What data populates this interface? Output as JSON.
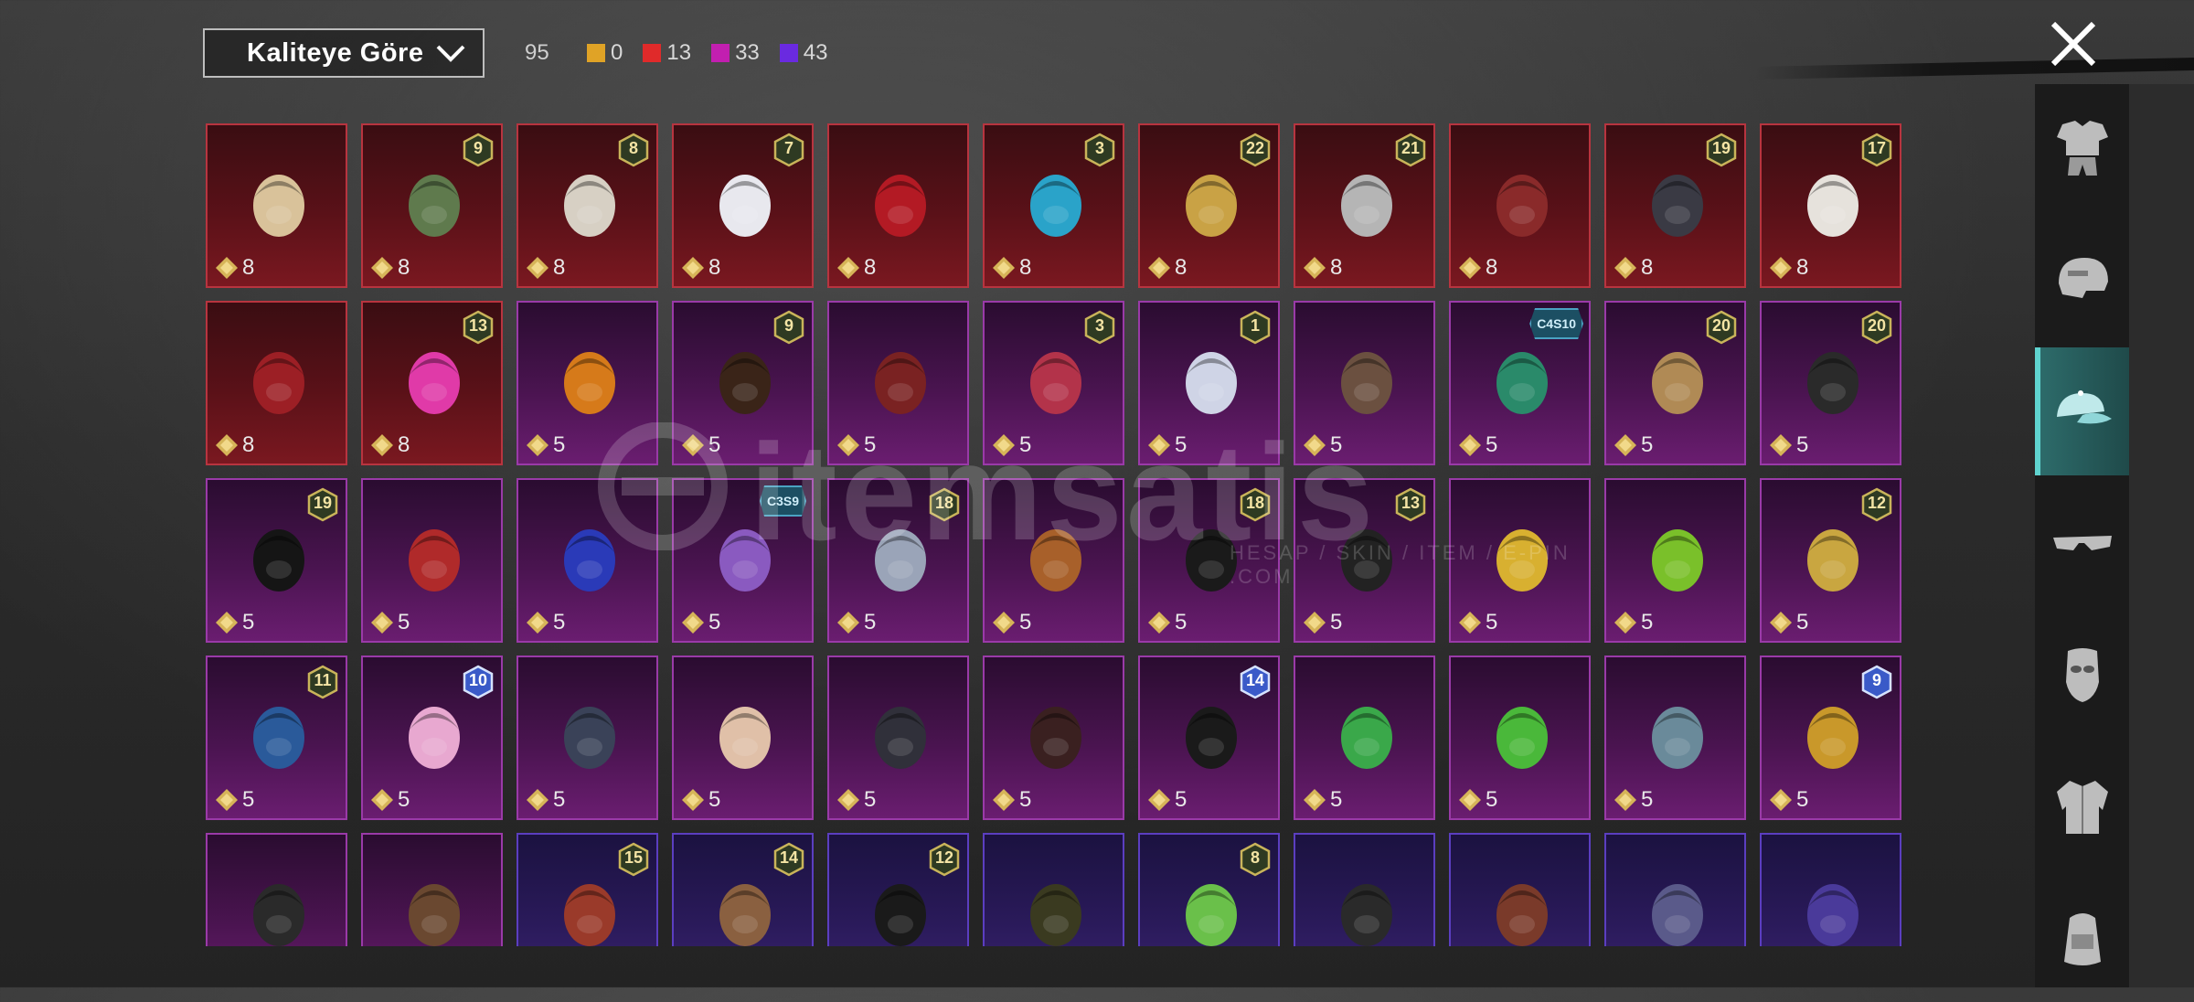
{
  "topbar": {
    "sort_label": "Kaliteye Göre",
    "total": "95",
    "rarity_counts": [
      {
        "color": "#e0a326",
        "count": "0"
      },
      {
        "color": "#e02a2a",
        "count": "13"
      },
      {
        "color": "#c21fb0",
        "count": "33"
      },
      {
        "color": "#6a2ae0",
        "count": "43"
      }
    ]
  },
  "watermark": {
    "text": "itemsatis",
    "sub": "HESAP / SKIN / ITEM / E-PIN .COM"
  },
  "categories": [
    {
      "name": "outfit-icon",
      "active": false
    },
    {
      "name": "helmet-icon",
      "active": false
    },
    {
      "name": "cap-icon",
      "active": true
    },
    {
      "name": "glasses-icon",
      "active": false
    },
    {
      "name": "mask-icon",
      "active": false
    },
    {
      "name": "jacket-icon",
      "active": false
    },
    {
      "name": "backpack-icon",
      "active": false
    }
  ],
  "items": [
    {
      "rarity": "red",
      "level": "",
      "price": "8",
      "art": "#d9c29a"
    },
    {
      "rarity": "red",
      "level": "9",
      "price": "8",
      "art": "#5f7a4d"
    },
    {
      "rarity": "red",
      "level": "8",
      "price": "8",
      "art": "#d7d0c4"
    },
    {
      "rarity": "red",
      "level": "7",
      "price": "8",
      "art": "#e8e8ee"
    },
    {
      "rarity": "red",
      "level": "",
      "price": "8",
      "art": "#b31a24"
    },
    {
      "rarity": "red",
      "level": "3",
      "price": "8",
      "art": "#2aa3c9"
    },
    {
      "rarity": "red",
      "level": "22",
      "price": "8",
      "art": "#c9a245"
    },
    {
      "rarity": "red",
      "level": "21",
      "price": "8",
      "art": "#b5b5b5"
    },
    {
      "rarity": "red",
      "level": "",
      "price": "8",
      "art": "#8a2a2a"
    },
    {
      "rarity": "red",
      "level": "19",
      "price": "8",
      "art": "#3a3a44"
    },
    {
      "rarity": "red",
      "level": "17",
      "price": "8",
      "art": "#e6e2dc"
    },
    {
      "rarity": "red",
      "level": "",
      "price": "8",
      "art": "#9c1f25"
    },
    {
      "rarity": "red",
      "level": "13",
      "price": "8",
      "art": "#e03aa8"
    },
    {
      "rarity": "purple",
      "level": "",
      "price": "5",
      "art": "#d67a1a"
    },
    {
      "rarity": "purple",
      "level": "9",
      "price": "5",
      "art": "#3a2418"
    },
    {
      "rarity": "purple",
      "level": "",
      "price": "5",
      "art": "#7a2222"
    },
    {
      "rarity": "purple",
      "level": "3",
      "price": "5",
      "art": "#b3334a"
    },
    {
      "rarity": "purple",
      "level": "1",
      "price": "5",
      "art": "#cfd4e6"
    },
    {
      "rarity": "purple",
      "level": "",
      "price": "5",
      "art": "#6b5040"
    },
    {
      "rarity": "purple",
      "level": "",
      "tag": "C4S10",
      "price": "5",
      "art": "#2a8a6a"
    },
    {
      "rarity": "purple",
      "level": "20",
      "price": "5",
      "art": "#b08a55"
    },
    {
      "rarity": "purple",
      "level": "20",
      "price": "5",
      "art": "#2a2a2a"
    },
    {
      "rarity": "purple",
      "level": "19",
      "price": "5",
      "art": "#151515"
    },
    {
      "rarity": "purple",
      "level": "",
      "price": "5",
      "art": "#b02a2a"
    },
    {
      "rarity": "purple",
      "level": "",
      "price": "5",
      "art": "#2a3ab8"
    },
    {
      "rarity": "purple",
      "level": "",
      "tag": "C3S9",
      "price": "5",
      "art": "#8a5ac0"
    },
    {
      "rarity": "purple",
      "level": "18",
      "price": "5",
      "art": "#9aa4b8"
    },
    {
      "rarity": "purple",
      "level": "",
      "price": "5",
      "art": "#a8602a"
    },
    {
      "rarity": "purple",
      "level": "18",
      "price": "5",
      "art": "#1a1a1a"
    },
    {
      "rarity": "purple",
      "level": "13",
      "price": "5",
      "art": "#222222"
    },
    {
      "rarity": "purple",
      "level": "",
      "price": "5",
      "art": "#d8b030"
    },
    {
      "rarity": "purple",
      "level": "",
      "price": "5",
      "art": "#7ac02a"
    },
    {
      "rarity": "purple",
      "level": "12",
      "price": "5",
      "art": "#c9a640"
    },
    {
      "rarity": "purple",
      "level": "11",
      "price": "5",
      "art": "#2a5a9a"
    },
    {
      "rarity": "purple",
      "level": "10",
      "blue": true,
      "price": "5",
      "art": "#e8a8d0"
    },
    {
      "rarity": "purple",
      "level": "",
      "price": "5",
      "art": "#3a4258"
    },
    {
      "rarity": "purple",
      "level": "",
      "price": "5",
      "art": "#e0c0a8"
    },
    {
      "rarity": "purple",
      "level": "",
      "price": "5",
      "art": "#30303a"
    },
    {
      "rarity": "purple",
      "level": "",
      "price": "5",
      "art": "#3a2020"
    },
    {
      "rarity": "purple",
      "level": "14",
      "blue": true,
      "price": "5",
      "art": "#1a1a1a"
    },
    {
      "rarity": "purple",
      "level": "",
      "price": "5",
      "art": "#3aa84a"
    },
    {
      "rarity": "purple",
      "level": "",
      "price": "5",
      "art": "#4ab83a"
    },
    {
      "rarity": "purple",
      "level": "",
      "price": "5",
      "art": "#6a8a9a"
    },
    {
      "rarity": "purple",
      "level": "9",
      "blue": true,
      "price": "5",
      "art": "#c9982a"
    },
    {
      "rarity": "purple",
      "level": "",
      "price": "",
      "art": "#2a2a2a"
    },
    {
      "rarity": "purple",
      "level": "",
      "price": "",
      "art": "#6a4830"
    },
    {
      "rarity": "violet",
      "level": "15",
      "price": "",
      "art": "#9a3a2a"
    },
    {
      "rarity": "violet",
      "level": "14",
      "price": "",
      "art": "#8a6040"
    },
    {
      "rarity": "violet",
      "level": "12",
      "price": "",
      "art": "#1a1a1a"
    },
    {
      "rarity": "violet",
      "level": "",
      "price": "",
      "art": "#3a3a20"
    },
    {
      "rarity": "violet",
      "level": "8",
      "price": "",
      "art": "#6ac04a"
    },
    {
      "rarity": "violet",
      "level": "",
      "price": "",
      "art": "#2a2a2a"
    },
    {
      "rarity": "violet",
      "level": "",
      "price": "",
      "art": "#7a3a2a"
    },
    {
      "rarity": "violet",
      "level": "",
      "price": "",
      "art": "#5a5a8a"
    },
    {
      "rarity": "violet",
      "level": "",
      "price": "",
      "art": "#4a3a9a"
    }
  ]
}
